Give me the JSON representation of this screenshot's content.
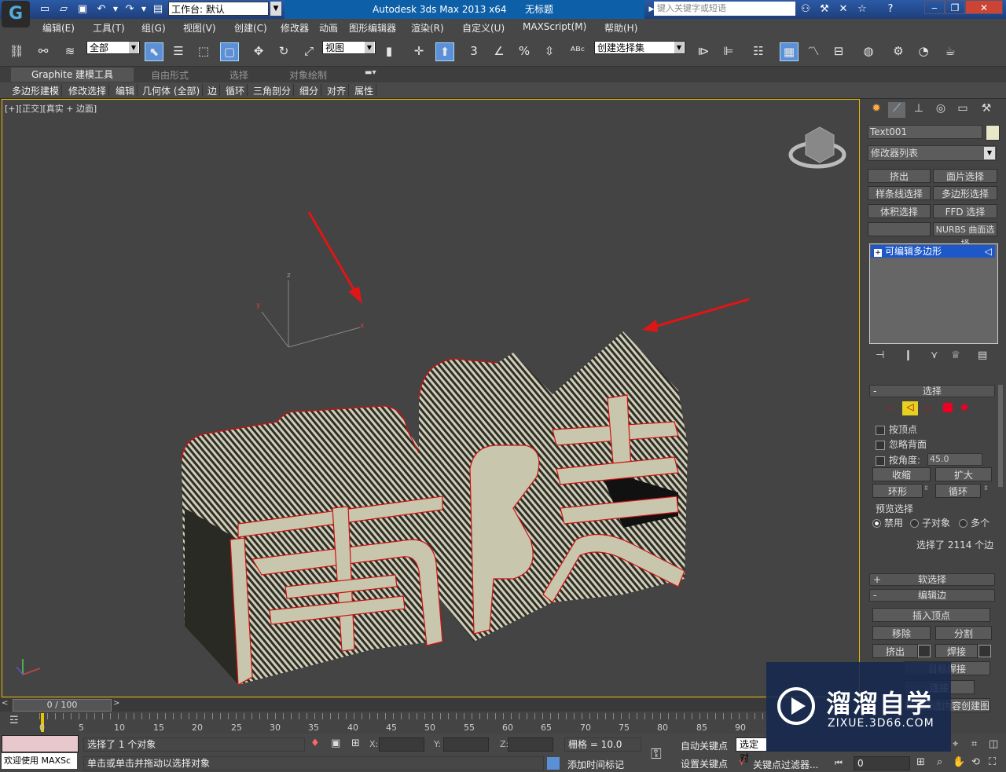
{
  "titlebar": {
    "workspace_label": "工作台: 默认",
    "app_name": "Autodesk 3ds Max  2013 x64",
    "doc_name": "无标题",
    "search_placeholder": "键入关键字或短语",
    "help": "?"
  },
  "menu": [
    "编辑(E)",
    "工具(T)",
    "组(G)",
    "视图(V)",
    "创建(C)",
    "修改器",
    "动画",
    "图形编辑器",
    "渲染(R)",
    "自定义(U)",
    "MAXScript(M)",
    "帮助(H)"
  ],
  "toolbar": {
    "filter_value": "全部",
    "coord_value": "视图",
    "selset_value": "创建选择集",
    "snap_3": "3"
  },
  "ribbon": {
    "tabs": [
      "Graphite 建模工具",
      "自由形式",
      "选择",
      "对象绘制"
    ],
    "subtabs": [
      "多边形建模",
      "修改选择",
      "编辑",
      "几何体 (全部)",
      "边",
      "循环",
      "三角剖分",
      "细分",
      "对齐",
      "属性"
    ]
  },
  "viewport": {
    "label_plus": "[+]",
    "label_view": "[正交]",
    "label_mode": "[真实 + 边面]",
    "text_char1": "南",
    "text_char2": "陵"
  },
  "cmdpanel": {
    "object_name": "Text001",
    "modifier_list": "修改器列表",
    "buttons": [
      "挤出",
      "面片选择",
      "样条线选择",
      "多边形选择",
      "体积选择",
      "FFD 选择",
      "",
      "NURBS 曲面选择"
    ],
    "stack_item": "可编辑多边形",
    "select_title": "选择",
    "by_vertex": "按顶点",
    "ignore_back": "忽略背面",
    "by_angle": "按角度:",
    "angle_value": "45.0",
    "shrink": "收缩",
    "grow": "扩大",
    "ring": "环形",
    "loop": "循环",
    "preview_title": "预览选择",
    "preview_opts": [
      "禁用",
      "子对象",
      "多个"
    ],
    "selected_info": "选择了 2114 个边",
    "soft_sel": "软选择",
    "edit_edges": "编辑边",
    "insert_vertex": "插入顶点",
    "remove": "移除",
    "split": "分割",
    "extrude": "挤出",
    "weld": "焊接",
    "target_weld": "目标焊接",
    "bridge": "连接",
    "create_shape": "利用所选内容创建图形"
  },
  "timeline": {
    "frame_label": "0 / 100",
    "ticks": [
      "0",
      "5",
      "10",
      "15",
      "20",
      "25",
      "30",
      "35",
      "40",
      "45",
      "50",
      "55",
      "60",
      "65",
      "70",
      "75",
      "80",
      "85",
      "90"
    ]
  },
  "status": {
    "welcome": "欢迎使用 MAXSc",
    "selected_objects": "选择了 1 个对象",
    "prompt": "单击或单击并拖动以选择对象",
    "x_label": "X:",
    "y_label": "Y:",
    "z_label": "Z:",
    "grid": "栅格 = 10.0",
    "add_time_tag": "添加时间标记",
    "auto_key": "自动关键点",
    "set_key": "设置关键点",
    "selected_dropdown": "选定对",
    "key_filter": "关键点过滤器...",
    "frame_value": "0"
  },
  "watermark": {
    "brand": "溜溜自学",
    "url": "ZIXUE.3D66.COM"
  },
  "colors": {
    "accent_blue": "#0d5fa8",
    "selection_red": "#d01010",
    "text_face": "#c8c6ad",
    "stack_highlight": "#1e58c8"
  }
}
